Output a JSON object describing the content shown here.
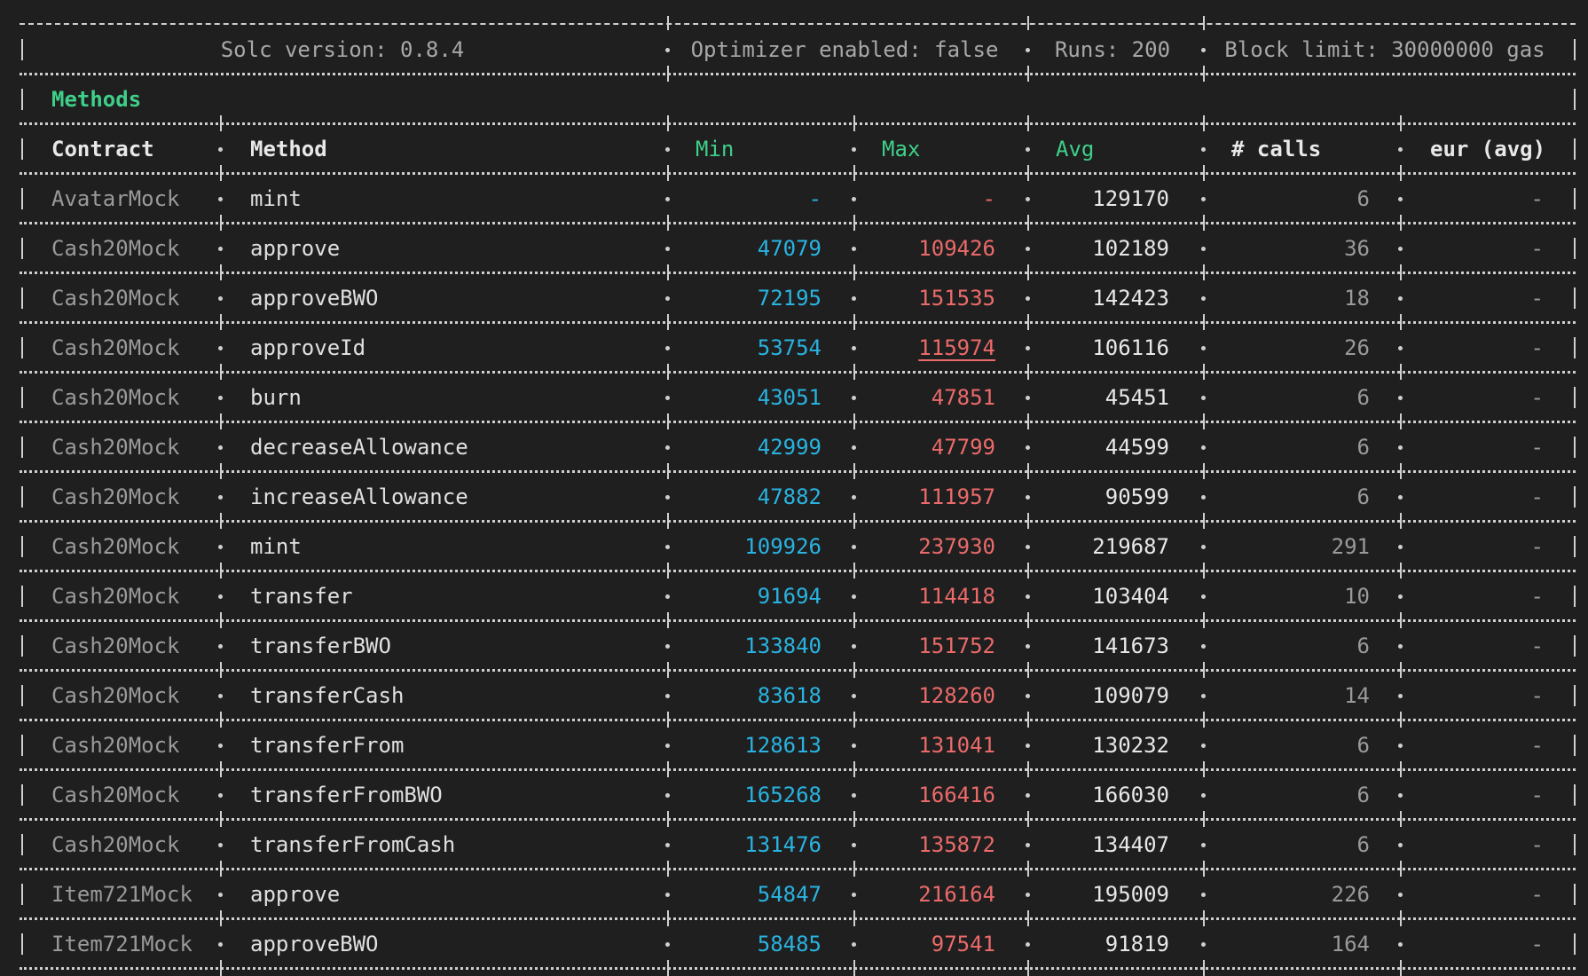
{
  "header": {
    "solc": "Solc version: 0.8.4",
    "optimizer": "Optimizer enabled: false",
    "runs": "Runs: 200",
    "block_limit": "Block limit: 30000000 gas"
  },
  "section_label": "Methods",
  "columns": {
    "contract": "Contract",
    "method": "Method",
    "min": "Min",
    "max": "Max",
    "avg": "Avg",
    "calls": "# calls",
    "eur": "eur (avg)"
  },
  "rows": [
    {
      "contract": "AvatarMock",
      "method": "mint",
      "min": "-",
      "max": "-",
      "avg": "129170",
      "calls": "6",
      "eur": "-"
    },
    {
      "contract": "Cash20Mock",
      "method": "approve",
      "min": "47079",
      "max": "109426",
      "avg": "102189",
      "calls": "36",
      "eur": "-"
    },
    {
      "contract": "Cash20Mock",
      "method": "approveBWO",
      "min": "72195",
      "max": "151535",
      "avg": "142423",
      "calls": "18",
      "eur": "-"
    },
    {
      "contract": "Cash20Mock",
      "method": "approveId",
      "min": "53754",
      "max": "115974",
      "avg": "106116",
      "calls": "26",
      "eur": "-",
      "max_underline": true
    },
    {
      "contract": "Cash20Mock",
      "method": "burn",
      "min": "43051",
      "max": "47851",
      "avg": "45451",
      "calls": "6",
      "eur": "-"
    },
    {
      "contract": "Cash20Mock",
      "method": "decreaseAllowance",
      "min": "42999",
      "max": "47799",
      "avg": "44599",
      "calls": "6",
      "eur": "-"
    },
    {
      "contract": "Cash20Mock",
      "method": "increaseAllowance",
      "min": "47882",
      "max": "111957",
      "avg": "90599",
      "calls": "6",
      "eur": "-"
    },
    {
      "contract": "Cash20Mock",
      "method": "mint",
      "min": "109926",
      "max": "237930",
      "avg": "219687",
      "calls": "291",
      "eur": "-"
    },
    {
      "contract": "Cash20Mock",
      "method": "transfer",
      "min": "91694",
      "max": "114418",
      "avg": "103404",
      "calls": "10",
      "eur": "-"
    },
    {
      "contract": "Cash20Mock",
      "method": "transferBWO",
      "min": "133840",
      "max": "151752",
      "avg": "141673",
      "calls": "6",
      "eur": "-"
    },
    {
      "contract": "Cash20Mock",
      "method": "transferCash",
      "min": "83618",
      "max": "128260",
      "avg": "109079",
      "calls": "14",
      "eur": "-"
    },
    {
      "contract": "Cash20Mock",
      "method": "transferFrom",
      "min": "128613",
      "max": "131041",
      "avg": "130232",
      "calls": "6",
      "eur": "-"
    },
    {
      "contract": "Cash20Mock",
      "method": "transferFromBWO",
      "min": "165268",
      "max": "166416",
      "avg": "166030",
      "calls": "6",
      "eur": "-"
    },
    {
      "contract": "Cash20Mock",
      "method": "transferFromCash",
      "min": "131476",
      "max": "135872",
      "avg": "134407",
      "calls": "6",
      "eur": "-"
    },
    {
      "contract": "Item721Mock",
      "method": "approve",
      "min": "54847",
      "max": "216164",
      "avg": "195009",
      "calls": "226",
      "eur": "-"
    },
    {
      "contract": "Item721Mock",
      "method": "approveBWO",
      "min": "58485",
      "max": "97541",
      "avg": "91819",
      "calls": "164",
      "eur": "-"
    }
  ],
  "colors": {
    "background": "#1f1f1f",
    "green": "#3ed089",
    "min_blue": "#29b3e0",
    "max_red": "#ec6a6a",
    "dim_gray": "#9a9a9a"
  }
}
